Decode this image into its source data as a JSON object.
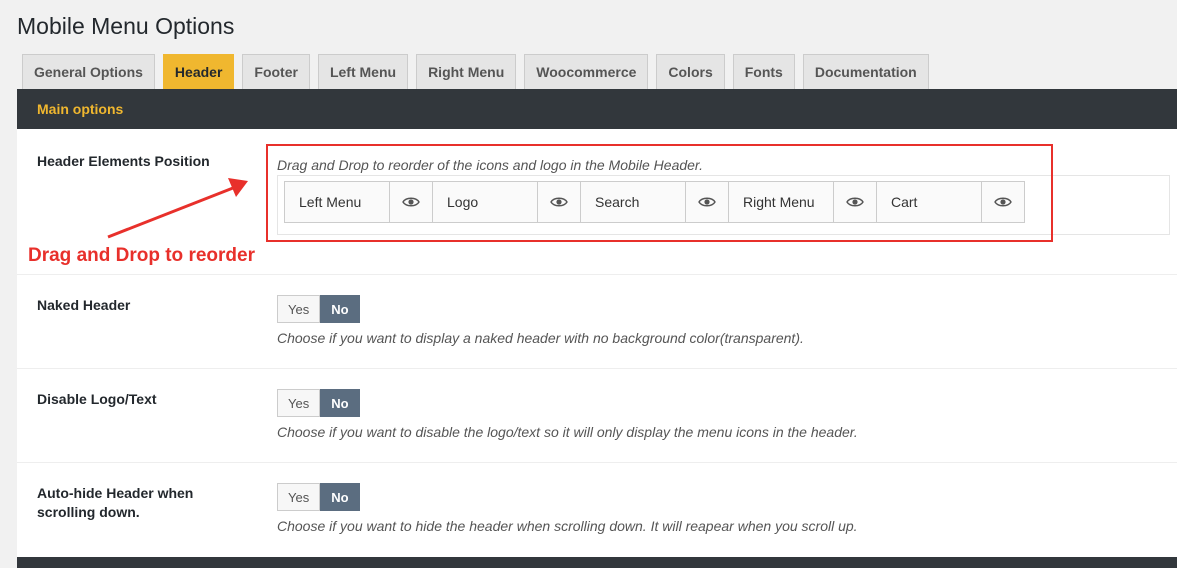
{
  "page": {
    "title": "Mobile Menu Options"
  },
  "tabs": [
    {
      "label": "General Options"
    },
    {
      "label": "Header",
      "active": true
    },
    {
      "label": "Footer"
    },
    {
      "label": "Left Menu"
    },
    {
      "label": "Right Menu"
    },
    {
      "label": "Woocommerce"
    },
    {
      "label": "Colors"
    },
    {
      "label": "Fonts"
    },
    {
      "label": "Documentation"
    }
  ],
  "section": {
    "title": "Main options"
  },
  "header_elements": {
    "label": "Header Elements Position",
    "description": "Drag and Drop to reorder of the icons and logo in the Mobile Header.",
    "items": [
      {
        "label": "Left Menu",
        "icon": "eye-icon"
      },
      {
        "label": "Logo",
        "icon": "eye-icon"
      },
      {
        "label": "Search",
        "icon": "eye-icon"
      },
      {
        "label": "Right Menu",
        "icon": "eye-icon"
      },
      {
        "label": "Cart",
        "icon": "eye-icon"
      }
    ]
  },
  "annotation": {
    "text": "Drag and Drop to reorder",
    "color": "#e8302b"
  },
  "options": [
    {
      "label": "Naked Header",
      "yes_label": "Yes",
      "no_label": "No",
      "selected": "No",
      "description": "Choose if you want to display a naked header with no background color(transparent)."
    },
    {
      "label": "Disable Logo/Text",
      "yes_label": "Yes",
      "no_label": "No",
      "selected": "No",
      "description": "Choose if you want to disable the logo/text so it will only display the menu icons in the header."
    },
    {
      "label": "Auto-hide Header when scrolling down.",
      "yes_label": "Yes",
      "no_label": "No",
      "selected": "No",
      "description": "Choose if you want to hide the header when scrolling down. It will reapear when you scroll up."
    }
  ],
  "colors": {
    "accent": "#f0b72f",
    "dark_bar": "#32373c",
    "toggle_selected": "#5b6d80",
    "annotation": "#e8302b"
  }
}
